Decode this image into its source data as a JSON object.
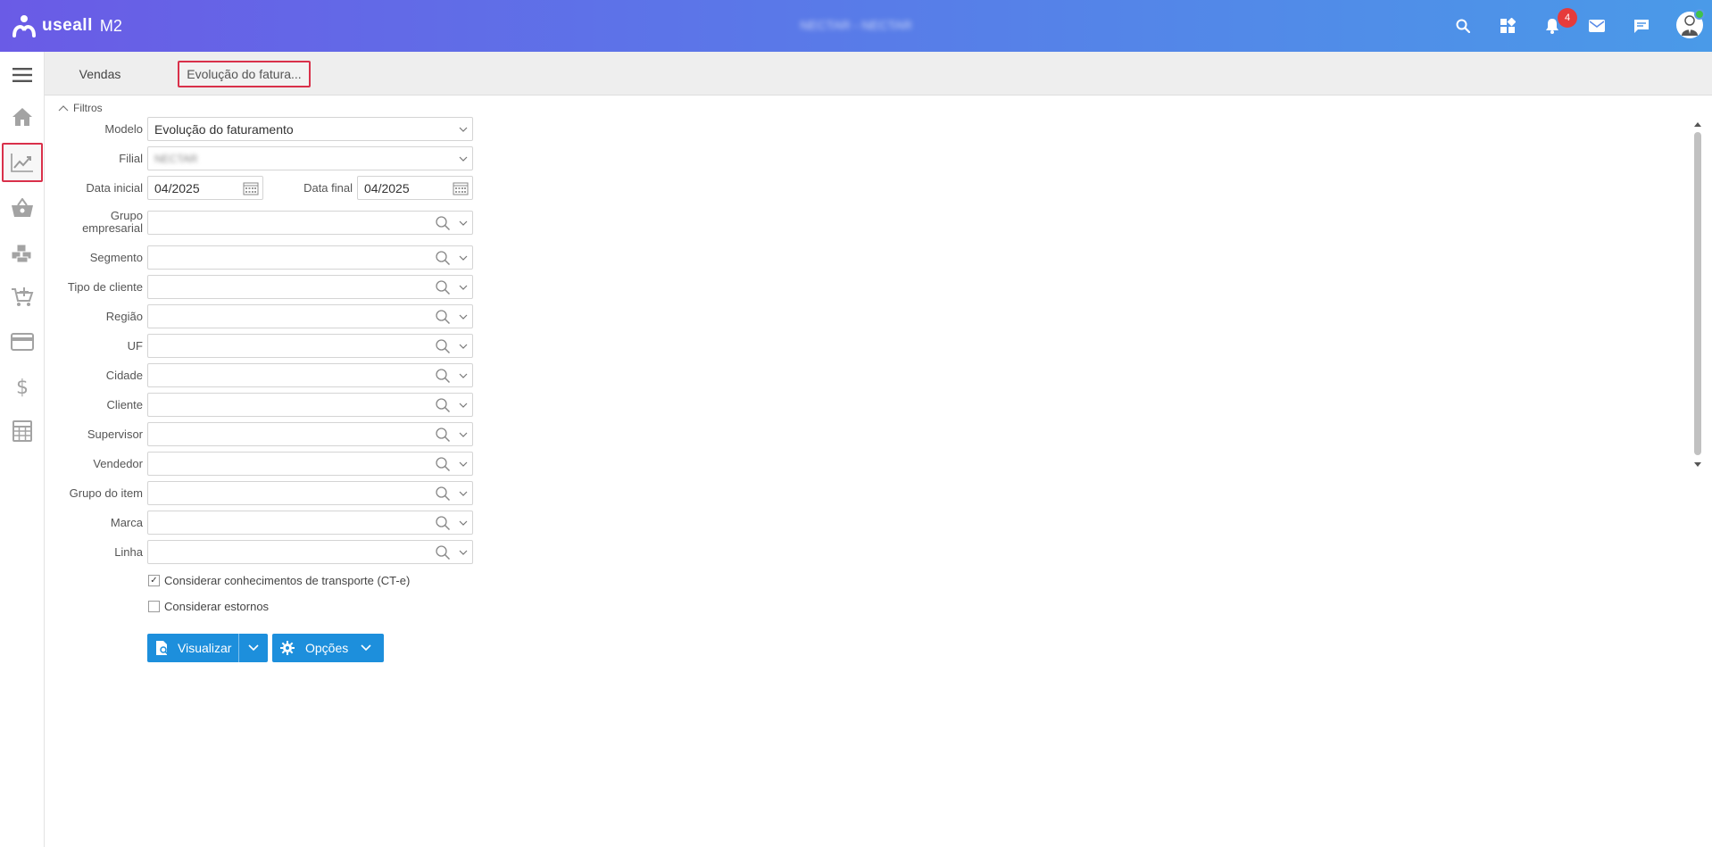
{
  "header": {
    "logo_word": "useall",
    "logo_suffix": "M2",
    "company": "NECTAR - NECTAR",
    "notifications_count": "4"
  },
  "tabs": [
    {
      "label": "Vendas"
    },
    {
      "label": "Evolução do fatura..."
    }
  ],
  "filters": {
    "section_label": "Filtros",
    "modelo_label": "Modelo",
    "modelo_value": "Evolução do faturamento",
    "filial_label": "Filial",
    "filial_value": "NECTAR",
    "data_inicial_label": "Data inicial",
    "data_inicial_value": "04/2025",
    "data_final_label": "Data final",
    "data_final_value": "04/2025",
    "lookups": [
      {
        "label": "Grupo empresarial"
      },
      {
        "label": "Segmento"
      },
      {
        "label": "Tipo de cliente"
      },
      {
        "label": "Região"
      },
      {
        "label": "UF"
      },
      {
        "label": "Cidade"
      },
      {
        "label": "Cliente"
      },
      {
        "label": "Supervisor"
      },
      {
        "label": "Vendedor"
      },
      {
        "label": "Grupo do item"
      },
      {
        "label": "Marca"
      },
      {
        "label": "Linha"
      }
    ],
    "check_cte_label": "Considerar conhecimentos de transporte (CT-e)",
    "check_cte_checked": true,
    "check_estornos_label": "Considerar estornos",
    "check_estornos_checked": false
  },
  "actions": {
    "visualizar_label": "Visualizar",
    "opcoes_label": "Opções"
  },
  "colors": {
    "accent": "#1d8fdc",
    "active_outline": "#d9304a",
    "badge": "#e63b3b"
  }
}
